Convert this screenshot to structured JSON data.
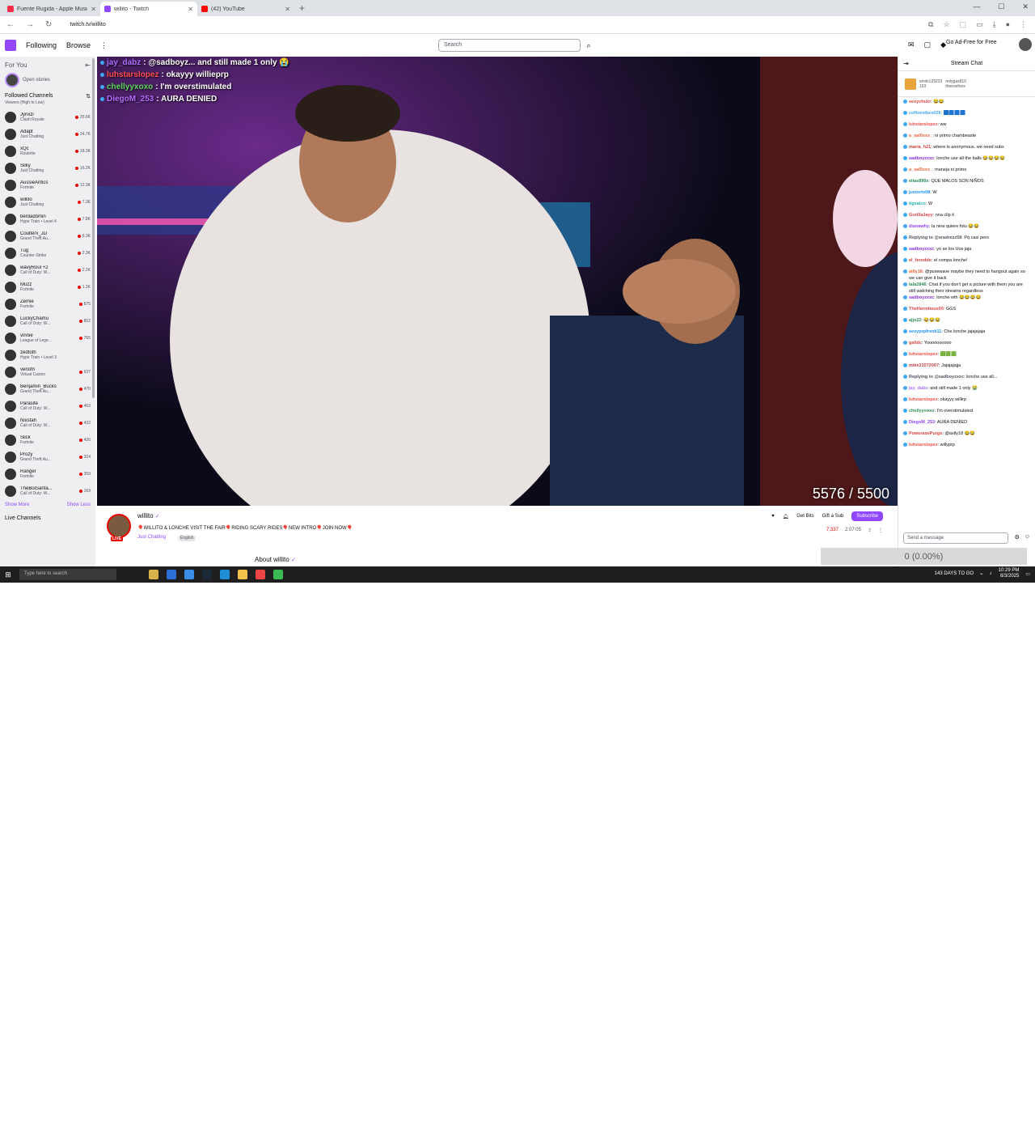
{
  "browser": {
    "tabs": [
      {
        "title": "Fuente Rugida - Apple Music",
        "color": "#fa2d48",
        "active": false
      },
      {
        "title": "willito - Twitch",
        "color": "#9146ff",
        "active": true
      },
      {
        "title": "(42) YouTube",
        "color": "#ff0000",
        "active": false
      }
    ],
    "new_tab": "+",
    "url": "twitch.tv/willito"
  },
  "twitch": {
    "nav": {
      "following": "Following",
      "browse": "Browse",
      "more": "⋮"
    },
    "search_placeholder": "Search",
    "ad_free": "Go Ad-Free for Free"
  },
  "sidebar": {
    "for_you": "For You",
    "collapse": "⇤",
    "open_stories": "Open stories",
    "followed_title": "Followed Channels",
    "followed_sub": "Viewers (High to Low)",
    "channels": [
      {
        "name": "Jynxzi",
        "cat": "Clash Royale",
        "viewers": "35.6K"
      },
      {
        "name": "Adapt",
        "cat": "Just Chatting",
        "viewers": "34.7K"
      },
      {
        "name": "xQc",
        "cat": "Roulette",
        "viewers": "18.3K"
      },
      {
        "name": "Silky",
        "cat": "Just Chatting",
        "viewers": "16.2K"
      },
      {
        "name": "AussieAntics",
        "cat": "Fortnite",
        "viewers": "12.3K"
      },
      {
        "name": "willito",
        "cat": "Just Chatting",
        "viewers": "7.3K"
      },
      {
        "name": "berdadomin",
        "cat": "Hype Train • Level 4",
        "viewers": "7.8K"
      },
      {
        "name": "Coulterx_JD",
        "cat": "Grand Theft Au...",
        "viewers": "6.3K"
      },
      {
        "name": "Tug",
        "cat": "Counter-Strike",
        "viewers": "2.3K"
      },
      {
        "name": "wavyRoul +2",
        "cat": "Call of Duty: W...",
        "viewers": "2.2K"
      },
      {
        "name": "Muzz",
        "cat": "Fortnite",
        "viewers": "1.2K"
      },
      {
        "name": "Zemie",
        "cat": "Fortnite",
        "viewers": "875"
      },
      {
        "name": "LuckyChamu",
        "cat": "Call of Duty: W...",
        "viewers": "802"
      },
      {
        "name": "vinnie",
        "cat": "League of Lege...",
        "viewers": "765"
      },
      {
        "name": "zedtoth",
        "cat": "Hype Train • Level 3",
        "viewers": ""
      },
      {
        "name": "venofn",
        "cat": "Virtual Casino",
        "viewers": "637"
      },
      {
        "name": "Benjamin_Bucks",
        "cat": "Grand Theft Au...",
        "viewers": "470"
      },
      {
        "name": "Parasite",
        "cat": "Call of Duty: W...",
        "viewers": "463"
      },
      {
        "name": "Nixstah",
        "cat": "Call of Duty: W...",
        "viewers": "432"
      },
      {
        "name": "Slick",
        "cat": "Fortnite",
        "viewers": "426"
      },
      {
        "name": "Prozy",
        "cat": "Grand Theft Au...",
        "viewers": "324"
      },
      {
        "name": "Ranger",
        "cat": "Fortnite",
        "viewers": "359"
      },
      {
        "name": "TheBoiSanta...",
        "cat": "Call of Duty: W...",
        "viewers": "169"
      }
    ],
    "show_more": "Show More",
    "show_less": "Show Less",
    "live_channels": "Live Channels"
  },
  "overlay_chat": [
    {
      "user": "jay_dabz",
      "text": ": @sadboyz... and still made 1 only 😭",
      "color": "#a970ff"
    },
    {
      "user": "luhstarslopez",
      "text": ": okayyy willieprp",
      "color": "#ff4f4f"
    },
    {
      "user": "chellyyxoxo",
      "text": ": I'm overstimulated",
      "color": "#5cd65c"
    },
    {
      "user": "DiegoM_253",
      "text": ": AURA DENIED",
      "color": "#b76bff"
    }
  ],
  "player": {
    "counter": "5576 / 5500"
  },
  "stream": {
    "channel": "willito",
    "verified": "✓",
    "title": "🎈WILLITO & LONCHE VISIT THE FAIR🎈RIDING SCARY RIDES🎈NEW INTRO🎈JOIN NOW🎈",
    "category": "Just Chatting",
    "tag": "English",
    "live": "LIVE",
    "get_bits": "Get Bits",
    "gift_sub": "Gift a Sub",
    "subscribe": "Subscribe",
    "viewers": "7,337",
    "uptime": "2:07:05",
    "about": "About willito"
  },
  "chat": {
    "title": "Stream Chat",
    "hype_user1": "smilo129223",
    "hype_user2": "onlygas810",
    "hype_count1": "153",
    "hype_user3": "theesefoos",
    "messages": [
      {
        "user": "sexychulo",
        "text": ": 😂😂",
        "color": "#d44"
      },
      {
        "user": "coffeevibes028",
        "text": ": 🟦🟦🟦🟦",
        "color": "#3fa9f5"
      },
      {
        "user": "luhstarslopez",
        "text": ": ww",
        "color": "#ff4f4f"
      },
      {
        "user": "a_sal0xxx_",
        "text": ": ni primo chambeaste",
        "color": "#e8663d"
      },
      {
        "user": "maria_h21",
        "text": ": where is anonymous. we need subs",
        "color": "#c44"
      },
      {
        "user": "sadboyzxxc",
        "text": ": lonche use all the balls 😂😂😂😂",
        "color": "#8a2be2"
      },
      {
        "user": "a_sal0xxx_",
        "text": ": maneja ni primo",
        "color": "#e8663d"
      },
      {
        "user": "elias890x",
        "text": ": QUE MALOS SON NIÑOS",
        "color": "#2e8b57"
      },
      {
        "user": "juniortv08",
        "text": ": W",
        "color": "#1e90ff"
      },
      {
        "user": "itgvalco",
        "text": ": W",
        "color": "#20b2aa"
      },
      {
        "user": "GorillaJayy",
        "text": ": nna clip it",
        "color": "#d44"
      },
      {
        "user": "dianawhy",
        "text": ": la nina quiere fotu 😂😂",
        "color": "#9146ff"
      },
      {
        "user": "Replying to @sradrezz58",
        "text": ": Pq casi pero",
        "color": "#53535f"
      },
      {
        "user": "sadboyzxxc",
        "text": ": yo se los Uos jaja",
        "color": "#8a2be2"
      },
      {
        "user": "el_ferodde",
        "text": ": el compa lonche!",
        "color": "#c44"
      },
      {
        "user": "ailly18",
        "text": ": @pusewave maybe they need to hangout again so we can give it back",
        "color": "#e8663d"
      },
      {
        "user": "lala2846",
        "text": ": Chat if you don't get a picture with them you are still watching their streams regardless",
        "color": "#2e8b57"
      },
      {
        "user": "sadboyzxxc",
        "text": ": lonche wth 😂😂😂😂",
        "color": "#8a2be2"
      },
      {
        "user": "TheHermiteus00",
        "text": ": GGS",
        "color": "#d44"
      },
      {
        "user": "ajjx22",
        "text": ": 😂😂😂",
        "color": "#2e8b57"
      },
      {
        "user": "sexyprpfrenk11",
        "text": ": Che lonche jajajajaja",
        "color": "#1e90ff"
      },
      {
        "user": "galldc",
        "text": ": Yoooooooooo",
        "color": "#d44"
      },
      {
        "user": "luhstarslopez",
        "text": ": 🟩🟩🟩",
        "color": "#ff4f4f"
      },
      {
        "user": "mike21072007",
        "text": ": Jajajajajja",
        "color": "#c44"
      },
      {
        "user": "Replying to @sadboyzxxc",
        "text": ": lonche use all...",
        "color": "#53535f"
      },
      {
        "user": "jay_dabz",
        "text": ": and still made 1 only 😭",
        "color": "#a970ff"
      },
      {
        "user": "luhstarslopez",
        "text": ": okayyy willirp",
        "color": "#ff4f4f"
      },
      {
        "user": "chellyyxoxo",
        "text": ": I'm overstimulated",
        "color": "#2e8b57"
      },
      {
        "user": "DiegoM_253",
        "text": ": AURA DENIED",
        "color": "#9146ff"
      },
      {
        "user": "PowerasePurgs",
        "text": ": @axlly18 😂😂",
        "color": "#d44"
      },
      {
        "user": "luhstarslopez",
        "text": ": willyprp",
        "color": "#ff4f4f"
      }
    ],
    "input_placeholder": "Send a message"
  },
  "overlay_progress": {
    "text": "0 (0.00%)",
    "fraction": 0.0
  },
  "taskbar": {
    "search": "Type here to search",
    "counter": "0",
    "days_to_go": "143 DAYS TO GO",
    "time": "10:29 PM",
    "date": "8/3/2025"
  },
  "colors": {
    "twitch_purple": "#9146ff",
    "live_red": "#eb0400"
  }
}
